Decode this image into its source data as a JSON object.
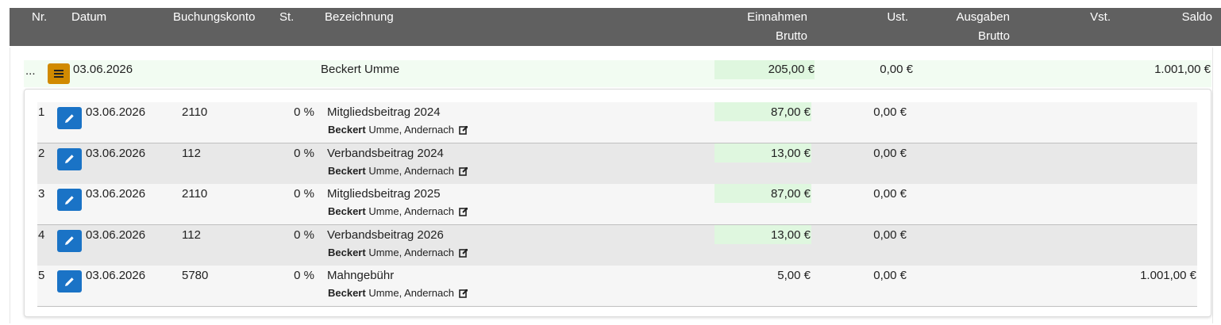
{
  "header": {
    "nr": "Nr.",
    "datum": "Datum",
    "konto": "Buchungskonto",
    "st": "St.",
    "bez": "Bezeichnung",
    "ein1": "Einnahmen",
    "ein2": "Brutto",
    "ust": "Ust.",
    "aus1": "Ausgaben",
    "aus2": "Brutto",
    "vst": "Vst.",
    "saldo": "Saldo"
  },
  "main": {
    "nr": "...",
    "menu_icon": "hamburger-icon",
    "date": "03.06.2026",
    "name": "Beckert Umme",
    "einnahmen": "205,00 €",
    "ust": "0,00 €",
    "saldo": "1.001,00 €"
  },
  "rows": [
    {
      "nr": "1",
      "date": "03.06.2026",
      "konto": "2110",
      "st": "0 %",
      "bez": "Mitgliedsbeitrag 2024",
      "payer_bold": "Beckert",
      "payer_rest": "Umme, Andernach",
      "einnahmen": "87,00 €",
      "ust": "0,00 €",
      "saldo": ""
    },
    {
      "nr": "2",
      "date": "03.06.2026",
      "konto": "112",
      "st": "0 %",
      "bez": "Verbandsbeitrag 2024",
      "payer_bold": "Beckert",
      "payer_rest": "Umme, Andernach",
      "einnahmen": "13,00 €",
      "ust": "0,00 €",
      "saldo": ""
    },
    {
      "nr": "3",
      "date": "03.06.2026",
      "konto": "2110",
      "st": "0 %",
      "bez": "Mitgliedsbeitrag 2025",
      "payer_bold": "Beckert",
      "payer_rest": "Umme, Andernach",
      "einnahmen": "87,00 €",
      "ust": "0,00 €",
      "saldo": ""
    },
    {
      "nr": "4",
      "date": "03.06.2026",
      "konto": "112",
      "st": "0 %",
      "bez": "Verbandsbeitrag 2026",
      "payer_bold": "Beckert",
      "payer_rest": "Umme, Andernach",
      "einnahmen": "13,00 €",
      "ust": "0,00 €",
      "saldo": ""
    },
    {
      "nr": "5",
      "date": "03.06.2026",
      "konto": "5780",
      "st": "0 %",
      "bez": "Mahngebühr",
      "payer_bold": "Beckert",
      "payer_rest": "Umme, Andernach",
      "einnahmen": "5,00 €",
      "ust": "0,00 €",
      "saldo": "1.001,00 €"
    }
  ],
  "colors": {
    "header_bg": "#606060",
    "edit_button": "#1a73c6",
    "menu_button": "#d18a00",
    "income_highlight": "#dff7df"
  }
}
